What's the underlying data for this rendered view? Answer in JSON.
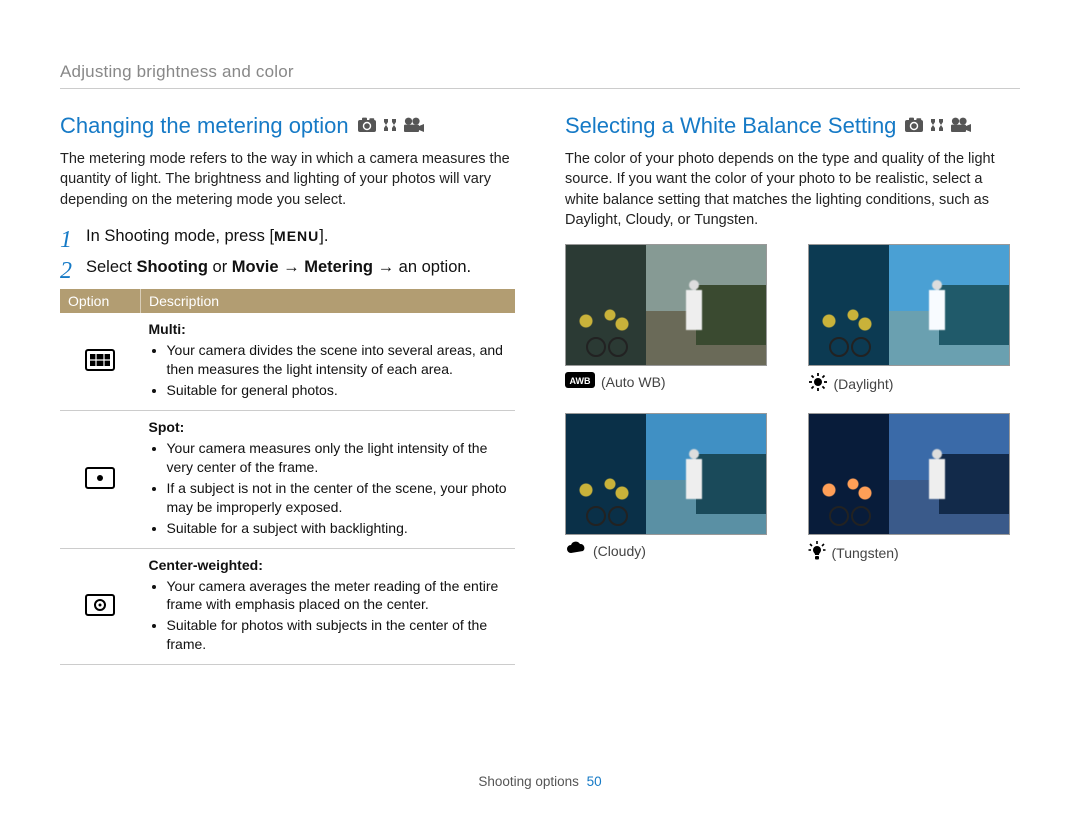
{
  "breadcrumb": "Adjusting brightness and color",
  "left": {
    "title": "Changing the metering option",
    "intro": "The metering mode refers to the way in which a camera measures the quantity of light. The brightness and lighting of your photos will vary depending on the metering mode you select.",
    "step1_prefix": "In Shooting mode, press [",
    "step1_menu": "MENU",
    "step1_suffix": "].",
    "step2_a": "Select ",
    "step2_b": "Shooting",
    "step2_c": " or ",
    "step2_d": "Movie",
    "step2_e": " → ",
    "step2_f": "Metering",
    "step2_g": " → an option.",
    "table": {
      "h1": "Option",
      "h2": "Description",
      "rows": [
        {
          "name": "Multi",
          "bullets": [
            "Your camera divides the scene into several areas, and then measures the light intensity of each area.",
            "Suitable for general photos."
          ]
        },
        {
          "name": "Spot",
          "bullets": [
            "Your camera measures only the light intensity of the very center of the frame.",
            "If a subject is not in the center of the scene, your photo may be improperly exposed.",
            "Suitable for a subject with backlighting."
          ]
        },
        {
          "name": "Center-weighted",
          "bullets": [
            "Your camera averages the meter reading of the entire frame with emphasis placed on the center.",
            "Suitable for photos with subjects in the center of the frame."
          ]
        }
      ]
    }
  },
  "right": {
    "title": "Selecting a White Balance Setting",
    "intro": "The color of your photo depends on the type and quality of the light source. If you want the color of your photo to be realistic, select a white balance setting that matches the lighting conditions, such as Daylight, Cloudy, or Tungsten.",
    "wb": [
      {
        "id": "awb",
        "label": "Auto WB"
      },
      {
        "id": "daylight",
        "label": "Daylight"
      },
      {
        "id": "cloudy",
        "label": "Cloudy"
      },
      {
        "id": "tungsten",
        "label": "Tungsten"
      }
    ]
  },
  "footer": {
    "section": "Shooting options",
    "page": "50"
  }
}
